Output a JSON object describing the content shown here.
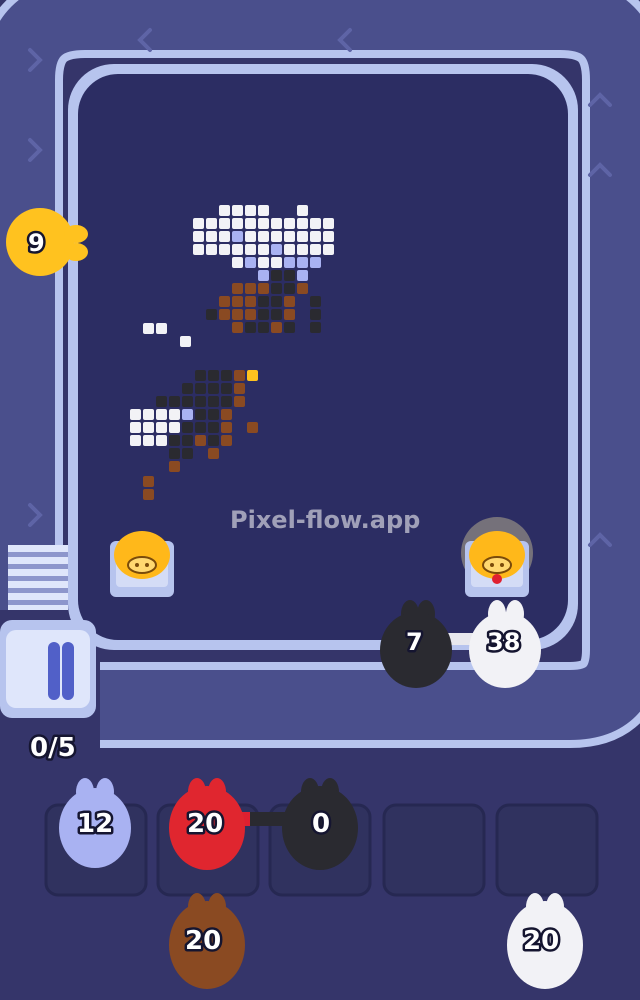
{
  "watermark": "Pixel-flow.app",
  "track_watermark": "Pixel-Flow.app",
  "counter": "0/5",
  "colors": {
    "background": "#35356a",
    "track_fill": "#4a4f8c",
    "track_rim": "#b7c4ee",
    "board": "#2c2d63",
    "yellow": "#ffc21f",
    "lavender": "#a9b2f2",
    "red": "#e0262f",
    "black": "#2a2a30",
    "brown": "#8a4a22",
    "white": "#f2f2f6",
    "gold": "#ffb81a"
  },
  "track_pigs": [
    {
      "color": "yellow",
      "count": "9"
    },
    {
      "color": "black",
      "count": "7"
    },
    {
      "color": "white",
      "count": "38"
    }
  ],
  "queue_slots": [
    {
      "color": "lavender",
      "count": "12"
    },
    {
      "color": "red",
      "count": "20"
    },
    {
      "color": "black",
      "count": "0"
    },
    {
      "empty": true
    },
    {
      "empty": true
    }
  ],
  "reserve_pigs": [
    {
      "color": "brown",
      "count": "20"
    },
    {
      "color": "white",
      "count": "20"
    }
  ],
  "golden_pigs": [
    {
      "glowing": false
    },
    {
      "glowing": true
    }
  ]
}
